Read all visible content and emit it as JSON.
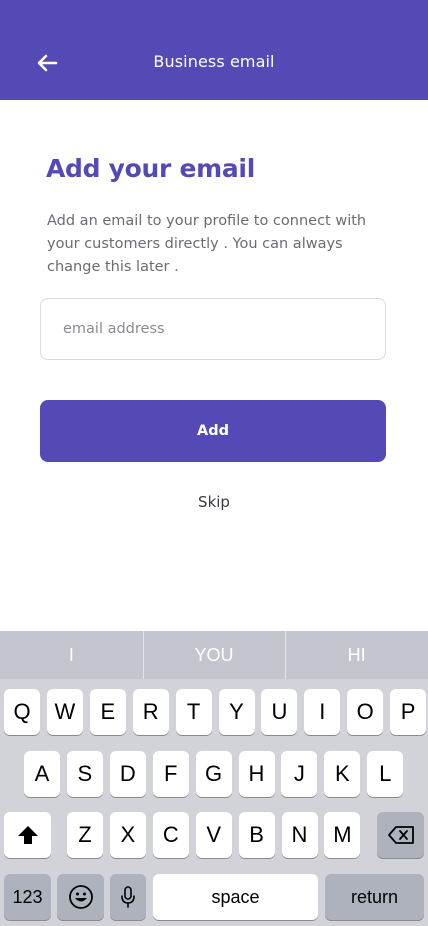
{
  "header": {
    "title": "Business email"
  },
  "main": {
    "heading": "Add your email",
    "description": "Add an email to your profile to connect with your customers directly . You can always change this later .",
    "email_placeholder": "email address",
    "email_value": "",
    "add_label": "Add",
    "skip_label": "Skip"
  },
  "keyboard": {
    "suggestions": [
      "I",
      "YOU",
      "HI"
    ],
    "row1": [
      "Q",
      "W",
      "E",
      "R",
      "T",
      "Y",
      "U",
      "I",
      "O",
      "P"
    ],
    "row2": [
      "A",
      "S",
      "D",
      "F",
      "G",
      "H",
      "J",
      "K",
      "L"
    ],
    "row3": [
      "Z",
      "X",
      "C",
      "V",
      "B",
      "N",
      "M"
    ],
    "numbers_label": "123",
    "space_label": "space",
    "return_label": "return"
  },
  "colors": {
    "brand": "#5549b5",
    "keyboard_bg": "#d1d3d9"
  }
}
